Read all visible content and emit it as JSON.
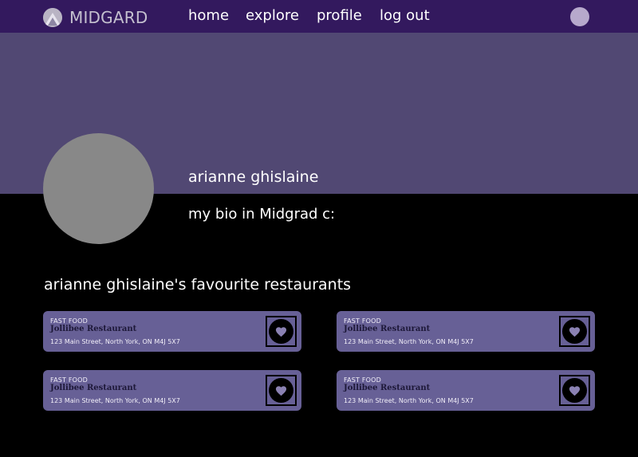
{
  "nav": {
    "brand": "MIDGARD",
    "links": [
      "home",
      "explore",
      "profile",
      "log out"
    ]
  },
  "profile": {
    "name": "arianne ghislaine",
    "bio": "my bio in Midgrad c:"
  },
  "favourites": {
    "title": "arianne ghislaine's favourite restaurants",
    "cards": [
      {
        "category": "FAST FOOD",
        "name": "Jollibee Restaurant",
        "address": "123 Main Street, North York, ON M4J 5X7"
      },
      {
        "category": "FAST FOOD",
        "name": "Jollibee Restaurant",
        "address": "123 Main Street, North York, ON M4J 5X7"
      },
      {
        "category": "FAST FOOD",
        "name": "Jollibee Restaurant",
        "address": "123 Main Street, North York, ON M4J 5X7"
      },
      {
        "category": "FAST FOOD",
        "name": "Jollibee Restaurant",
        "address": "123 Main Street, North York, ON M4J 5X7"
      }
    ]
  },
  "icons": {
    "brand": "mountain-logo-icon",
    "avatar": "user-avatar-icon",
    "favourite": "heart-icon"
  },
  "colors": {
    "navbar": "#33195e",
    "banner": "#514873",
    "card": "#676096",
    "background": "#000000"
  }
}
